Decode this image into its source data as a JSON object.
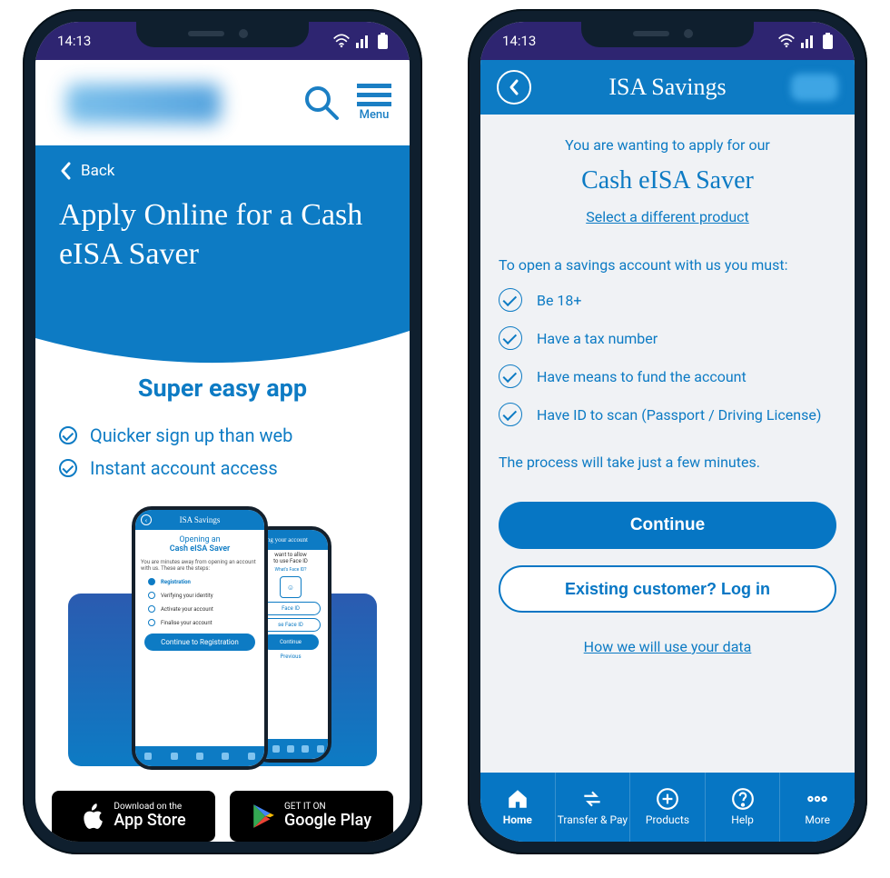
{
  "status": {
    "time": "14:13"
  },
  "phone1": {
    "menu_label": "Menu",
    "back_label": "Back",
    "hero_title": "Apply Online for a Cash eISA Saver",
    "section_title": "Super easy app",
    "benefits": [
      "Quicker sign up than web",
      "Instant account access"
    ],
    "mini_left": {
      "header": "ISA Savings",
      "h1": "Opening an",
      "h2": "Cash eISA Saver",
      "lead": "You are minutes away from opening an account with us. These are the steps:",
      "steps": [
        "Registration",
        "Verifying your identity",
        "Activate your account",
        "Finalise your account"
      ],
      "cta": "Continue to Registration"
    },
    "mini_right": {
      "header": "curing your account",
      "q1": "want to allow",
      "q2": "to use Face ID",
      "whats": "What's Face ID?",
      "opt1": "Face ID",
      "opt2": "se Face ID",
      "cta": "Continue",
      "prev": "Previous"
    },
    "store": {
      "apple_s": "Download on the",
      "apple_b": "App Store",
      "google_s": "GET IT ON",
      "google_b": "Google Play"
    }
  },
  "phone2": {
    "title": "ISA Savings",
    "intro": "You are wanting to apply for our",
    "product": "Cash eISA Saver",
    "select_link": "Select a different product",
    "must": "To open a savings account with us you must:",
    "reqs": [
      "Be 18+",
      "Have a tax number",
      "Have means to fund the account",
      "Have ID to scan (Passport / Driving License)"
    ],
    "minutes": "The process will take just a few minutes.",
    "continue_label": "Continue",
    "existing_label": "Existing customer? Log in",
    "data_link": "How we will use your data",
    "tabs": {
      "home": "Home",
      "transfer": "Transfer & Pay",
      "products": "Products",
      "help": "Help",
      "more": "More"
    }
  }
}
